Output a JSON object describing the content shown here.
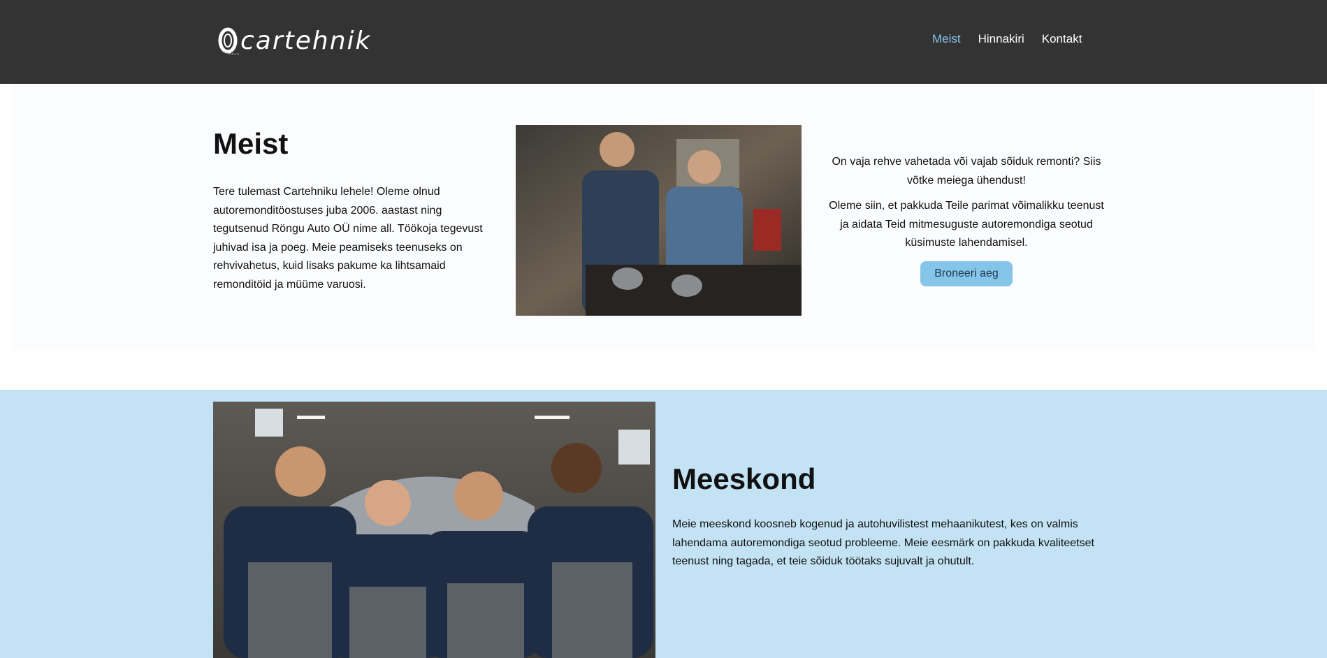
{
  "header": {
    "logo_text": "cartehnik",
    "nav": [
      {
        "label": "Meist",
        "active": true
      },
      {
        "label": "Hinnakiri",
        "active": false
      },
      {
        "label": "Kontakt",
        "active": false
      }
    ]
  },
  "meist": {
    "title": "Meist",
    "text": "Tere tulemast Cartehniku lehele! Oleme olnud autoremonditöostuses juba 2006. aastast ning tegutsenud Röngu Auto OÜ nime all. Töökoja tegevust juhivad isa ja poeg. Meie peamiseks teenuseks on rehvivahetus, kuid lisaks pakume ka lihtsamaid remonditöid ja müüme varuosi.",
    "image_icon": "mechanics-photo",
    "cta_text_1": "On vaja rehve vahetada või vajab sõiduk remonti? Siis võtke meiega ühendust!",
    "cta_text_2": "Oleme siin, et pakkuda Teile parimat võimalikku teenust ja aidata Teid mitmesuguste autoremondiga seotud küsimuste lahendamisel.",
    "button_label": "Broneeri aeg"
  },
  "team": {
    "title": "Meeskond",
    "text": "Meie meeskond koosneb kogenud ja autohuvilistest mehaanikutest, kes on valmis lahendama autoremondiga seotud probleeme. Meie eesmärk on pakkuda kvaliteetset teenust ning tagada, et teie sõiduk töötaks sujuvalt ja ohutult.",
    "image_icon": "team-photo"
  },
  "colors": {
    "header_bg": "#333333",
    "accent": "#86c5ea",
    "team_bg": "#c3e3f4"
  }
}
